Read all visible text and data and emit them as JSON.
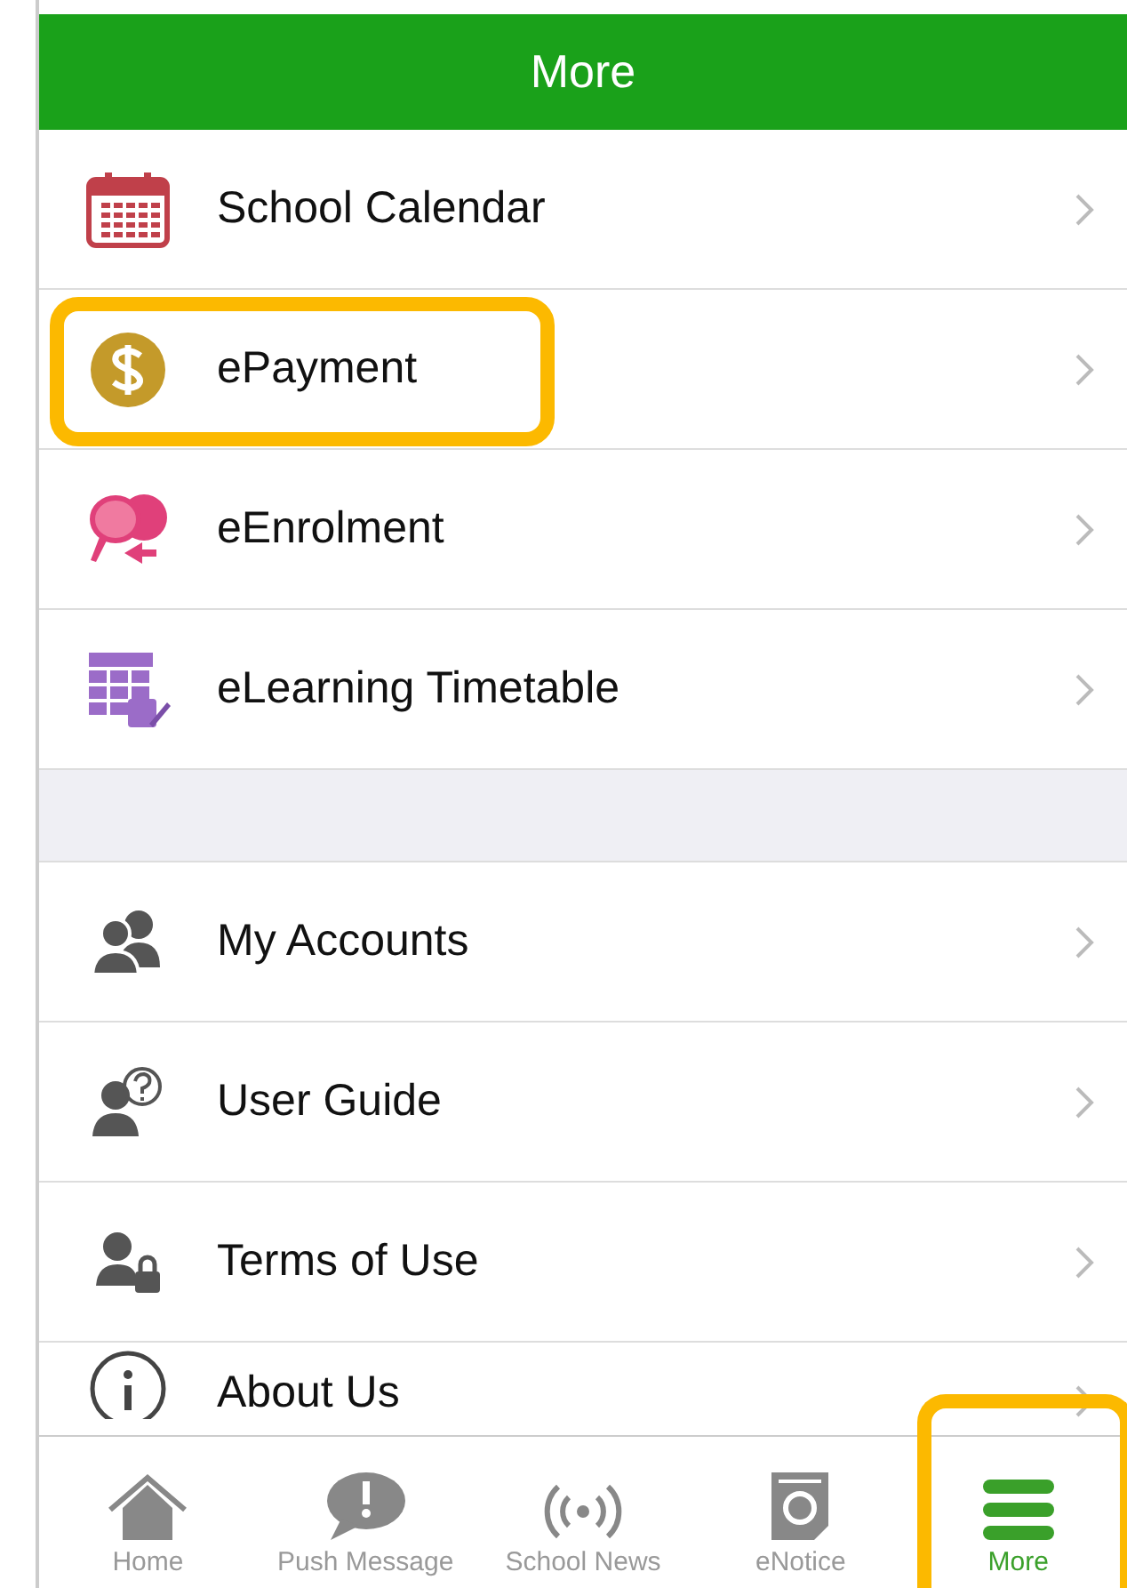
{
  "header": {
    "title": "More"
  },
  "sections": [
    {
      "items": [
        {
          "kind": "calendar",
          "label": "School Calendar",
          "highlighted": false
        },
        {
          "kind": "payment",
          "label": "ePayment",
          "highlighted": true
        },
        {
          "kind": "enrolment",
          "label": "eEnrolment",
          "highlighted": false
        },
        {
          "kind": "timetable",
          "label": "eLearning Timetable",
          "highlighted": false
        }
      ]
    },
    {
      "items": [
        {
          "kind": "accounts",
          "label": "My Accounts",
          "highlighted": false
        },
        {
          "kind": "guide",
          "label": "User Guide",
          "highlighted": false
        },
        {
          "kind": "terms",
          "label": "Terms of Use",
          "highlighted": false
        },
        {
          "kind": "about",
          "label": "About Us",
          "highlighted": false
        }
      ]
    }
  ],
  "tabs": [
    {
      "kind": "home",
      "label": "Home",
      "selected": false,
      "highlighted": false
    },
    {
      "kind": "push",
      "label": "Push Message",
      "selected": false,
      "highlighted": false
    },
    {
      "kind": "news",
      "label": "School News",
      "selected": false,
      "highlighted": false
    },
    {
      "kind": "notice",
      "label": "eNotice",
      "selected": false,
      "highlighted": false
    },
    {
      "kind": "more",
      "label": "More",
      "selected": true,
      "highlighted": true
    }
  ]
}
